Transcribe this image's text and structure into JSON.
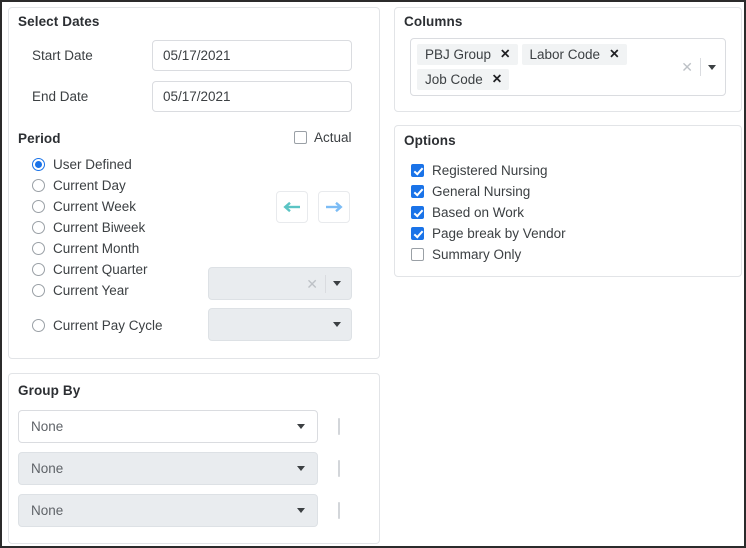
{
  "select_dates": {
    "title": "Select Dates",
    "start_date_label": "Start Date",
    "start_date_value": "05/17/2021",
    "end_date_label": "End Date",
    "end_date_value": "05/17/2021"
  },
  "period": {
    "title": "Period",
    "actual_label": "Actual",
    "actual_checked": false,
    "options": [
      {
        "label": "User Defined",
        "selected": true
      },
      {
        "label": "Current Day",
        "selected": false
      },
      {
        "label": "Current Week",
        "selected": false
      },
      {
        "label": "Current Biweek",
        "selected": false
      },
      {
        "label": "Current Month",
        "selected": false
      },
      {
        "label": "Current Quarter",
        "selected": false
      },
      {
        "label": "Current Year",
        "selected": false
      },
      {
        "label": "Current Pay Cycle",
        "selected": false
      }
    ],
    "prev_icon": "arrow-left-icon",
    "next_icon": "arrow-right-icon",
    "prev_arrow_color": "#5bc4c4",
    "next_arrow_color": "#7cbcf5",
    "period_select_value": "",
    "pay_cycle_select_value": "",
    "clear_icon": "close-icon",
    "caret_icon": "chevron-down-icon"
  },
  "group_by": {
    "title": "Group By",
    "rows": [
      {
        "value": "None",
        "checked": false,
        "enabled": true
      },
      {
        "value": "None",
        "checked": false,
        "enabled": false
      },
      {
        "value": "None",
        "checked": false,
        "enabled": false
      }
    ]
  },
  "columns": {
    "title": "Columns",
    "chips": [
      {
        "label": "PBJ Group",
        "remove_icon": "close-icon"
      },
      {
        "label": "Labor Code",
        "remove_icon": "close-icon"
      },
      {
        "label": "Job Code",
        "remove_icon": "close-icon"
      }
    ],
    "clear_icon": "close-icon",
    "caret_icon": "chevron-down-icon"
  },
  "options": {
    "title": "Options",
    "items": [
      {
        "label": "Registered Nursing",
        "checked": true
      },
      {
        "label": "General Nursing",
        "checked": true
      },
      {
        "label": "Based on Work",
        "checked": true
      },
      {
        "label": "Page break by Vendor",
        "checked": true
      },
      {
        "label": "Summary Only",
        "checked": false
      }
    ]
  },
  "colors": {
    "accent_checkbox": "#1a73e8",
    "accent_radio": "#1a73e8",
    "disabled_field": "#e9ecef",
    "chip_background": "#f1f3f4"
  }
}
